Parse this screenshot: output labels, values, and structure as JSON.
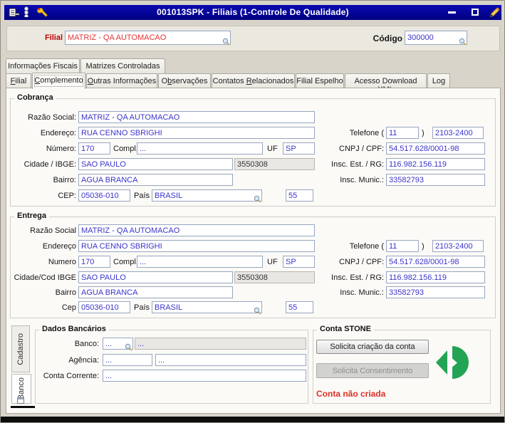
{
  "titlebar": {
    "title": "001013SPK - Filiais (1-Controle De Qualidade)",
    "bg_color": "#000096"
  },
  "header": {
    "filial_label": "Filial",
    "filial_value": "MATRIZ - QA AUTOMACAO",
    "filial_color": "#E23535",
    "codigo_label": "Código",
    "codigo_value": "300000"
  },
  "tabs_top": [
    {
      "label": "Informações Fiscais"
    },
    {
      "label": "Matrizes Controladas"
    }
  ],
  "tabs_main": [
    {
      "pre": "",
      "key": "F",
      "post": "ilial"
    },
    {
      "pre": "",
      "key": "C",
      "post": "omplemento",
      "active": true
    },
    {
      "pre": "",
      "key": "O",
      "post": "utras Informações"
    },
    {
      "pre": "O",
      "key": "b",
      "post": "servações"
    },
    {
      "pre": "Contatos ",
      "key": "R",
      "post": "elacionados"
    },
    {
      "pre": "Filial Espelho",
      "key": "",
      "post": ""
    },
    {
      "pre": "Acesso Download XML",
      "key": "",
      "post": ""
    },
    {
      "pre": "Log",
      "key": "",
      "post": ""
    }
  ],
  "cobranca": {
    "title": "Cobrança",
    "labels": {
      "razao": "Razão Social:",
      "endereco": "Endereço:",
      "numero": "Número:",
      "compl": "Compl.",
      "uf": "UF",
      "cidade": "Cidade / IBGE:",
      "bairro": "Bairro:",
      "cep": "CEP:",
      "pais": "País",
      "telefone": "Telefone (",
      "telefone_close": ")",
      "cnpj": "CNPJ / CPF:",
      "insc_est": "Insc. Est. / RG:",
      "insc_mun": "Insc. Munic.:"
    },
    "values": {
      "razao": "MATRIZ - QA AUTOMACAO",
      "endereco": "RUA CENNO SBRIGHI",
      "numero": "170",
      "compl": "...",
      "uf": "SP",
      "cidade": "SAO PAULO",
      "ibge": "3550308",
      "bairro": "AGUA BRANCA",
      "cep": "05036-010",
      "pais": "BRASIL",
      "ddi": "55",
      "ddd": "11",
      "telefone": "2103-2400",
      "cnpj": "54.517.628/0001-98",
      "insc_est": "116.982.156.119",
      "insc_mun": "33582793"
    }
  },
  "entrega": {
    "title": "Entrega",
    "labels": {
      "razao": "Razão Social",
      "endereco": "Endereço",
      "numero": "Numero",
      "compl": "Compl.",
      "uf": "UF",
      "cidade": "Cidade/Cod IBGE",
      "bairro": "Bairro",
      "cep": "Cep",
      "pais": "País",
      "telefone": "Telefone (",
      "telefone_close": ")",
      "cnpj": "CNPJ / CPF:",
      "insc_est": "Insc. Est. / RG:",
      "insc_mun": "Insc. Munic.:"
    },
    "values": {
      "razao": "MATRIZ - QA AUTOMACAO",
      "endereco": "RUA CENNO SBRIGHI",
      "numero": "170",
      "compl": "...",
      "uf": "SP",
      "cidade": "SAO PAULO",
      "ibge": "3550308",
      "bairro": "AGUA BRANCA",
      "cep": "05036-010",
      "pais": "BRASIL",
      "ddi": "55",
      "ddd": "11",
      "telefone": "2103-2400",
      "cnpj": "54.517.628/0001-98",
      "insc_est": "116.982.156.119",
      "insc_mun": "33582793"
    }
  },
  "bottom": {
    "side_tabs": [
      {
        "label": "Cadastro"
      },
      {
        "label": "Banco",
        "active": true
      }
    ],
    "dados_bancarios": {
      "title": "Dados Bancários",
      "labels": {
        "banco": "Banco:",
        "agencia": "Agência:",
        "conta": "Conta Corrente:"
      },
      "values": {
        "banco_cod": "...",
        "banco_nome": "...",
        "agencia_cod": "...",
        "agencia_compl": "...",
        "conta": "..."
      }
    },
    "conta_stone": {
      "title": "Conta STONE",
      "btn_criar": "Solicita criação da conta",
      "btn_consentimento": "Solicita Consentimento",
      "status": "Conta não criada",
      "status_color": "#D93025",
      "logo_color": "#23A455"
    }
  }
}
